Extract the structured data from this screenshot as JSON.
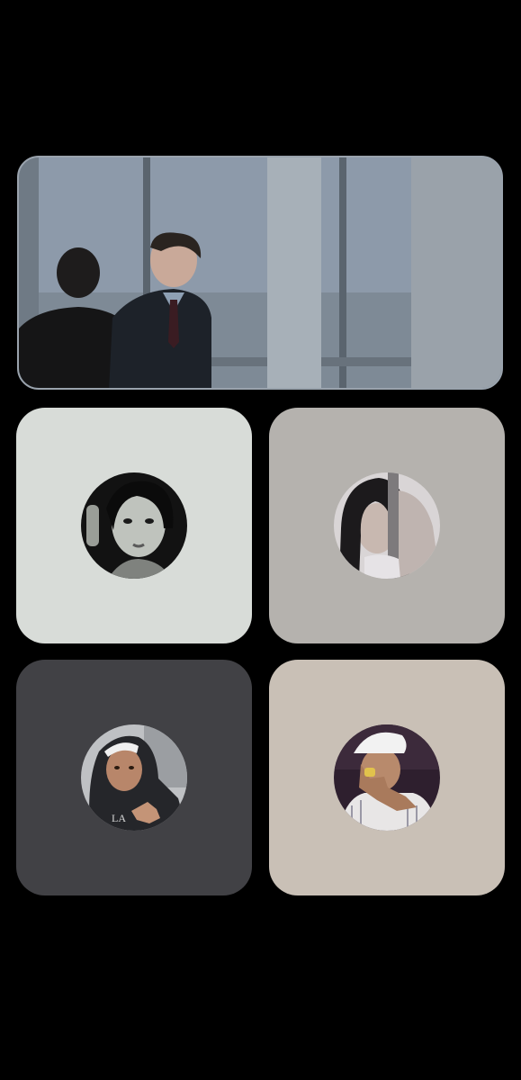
{
  "call": {
    "shared_video": {
      "icon": "video-frame-two-men-office-window"
    },
    "participants": [
      {
        "tile_color": "#d8dcd8",
        "avatar_icon": "avatar-woman-bw-photo"
      },
      {
        "tile_color": "#b5b2ae",
        "avatar_icon": "avatar-woman-dark-hair"
      },
      {
        "tile_color": "#414145",
        "avatar_icon": "avatar-man-hoodie-cap"
      },
      {
        "tile_color": "#c9c0b6",
        "avatar_icon": "avatar-man-white-cap"
      }
    ]
  }
}
